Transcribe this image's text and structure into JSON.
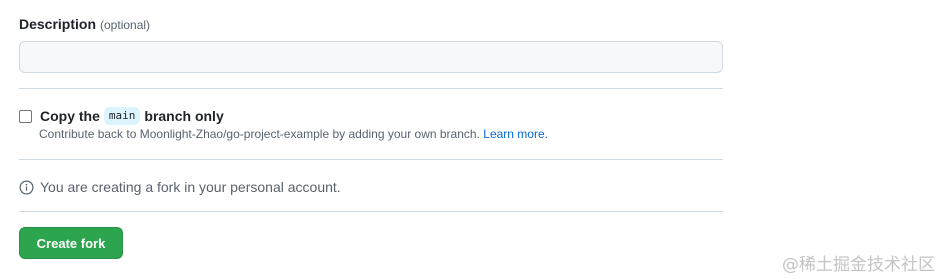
{
  "description_field": {
    "label": "Description",
    "optional": "(optional)",
    "value": "",
    "placeholder": ""
  },
  "copy_branch": {
    "checked": false,
    "label_before": "Copy the",
    "branch": "main",
    "label_after": "branch only",
    "note": "Contribute back to Moonlight-Zhao/go-project-example by adding your own branch.",
    "learn_more": "Learn more."
  },
  "info": {
    "icon": "info-icon",
    "text": "You are creating a fork in your personal account."
  },
  "create_button": {
    "label": "Create fork",
    "color": "#2da44e"
  },
  "watermark": {
    "text": "@稀土掘金技术社区"
  }
}
